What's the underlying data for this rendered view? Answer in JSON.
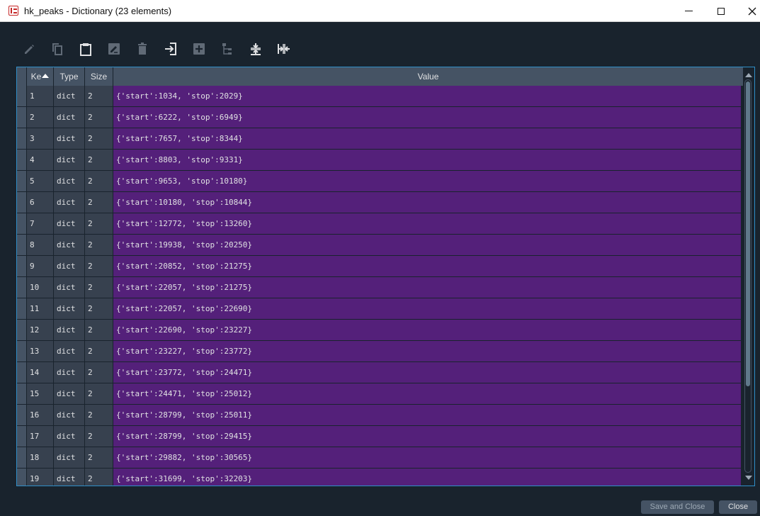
{
  "window": {
    "title": "hk_peaks - Dictionary (23 elements)",
    "icon": "spyder-app-icon",
    "controls": [
      "minimize-icon",
      "maximize-icon",
      "close-icon"
    ]
  },
  "toolbar": {
    "icons": [
      "edit-icon",
      "copy-icon",
      "paste-icon",
      "rename-icon",
      "delete-icon",
      "insert-icon",
      "insert-above-icon",
      "view-tree-icon",
      "resize-rows-icon",
      "resize-columns-icon"
    ]
  },
  "table": {
    "headers": {
      "key": "Ke",
      "type": "Type",
      "size": "Size",
      "value": "Value"
    },
    "sort_column": "key",
    "sort_order": "ascending",
    "rows": [
      {
        "key": "1",
        "type": "dict",
        "size": "2",
        "value": "{'start':1034, 'stop':2029}"
      },
      {
        "key": "2",
        "type": "dict",
        "size": "2",
        "value": "{'start':6222, 'stop':6949}"
      },
      {
        "key": "3",
        "type": "dict",
        "size": "2",
        "value": "{'start':7657, 'stop':8344}"
      },
      {
        "key": "4",
        "type": "dict",
        "size": "2",
        "value": "{'start':8803, 'stop':9331}"
      },
      {
        "key": "5",
        "type": "dict",
        "size": "2",
        "value": "{'start':9653, 'stop':10180}"
      },
      {
        "key": "6",
        "type": "dict",
        "size": "2",
        "value": "{'start':10180, 'stop':10844}"
      },
      {
        "key": "7",
        "type": "dict",
        "size": "2",
        "value": "{'start':12772, 'stop':13260}"
      },
      {
        "key": "8",
        "type": "dict",
        "size": "2",
        "value": "{'start':19938, 'stop':20250}"
      },
      {
        "key": "9",
        "type": "dict",
        "size": "2",
        "value": "{'start':20852, 'stop':21275}"
      },
      {
        "key": "10",
        "type": "dict",
        "size": "2",
        "value": "{'start':22057, 'stop':21275}"
      },
      {
        "key": "11",
        "type": "dict",
        "size": "2",
        "value": "{'start':22057, 'stop':22690}"
      },
      {
        "key": "12",
        "type": "dict",
        "size": "2",
        "value": "{'start':22690, 'stop':23227}"
      },
      {
        "key": "13",
        "type": "dict",
        "size": "2",
        "value": "{'start':23227, 'stop':23772}"
      },
      {
        "key": "14",
        "type": "dict",
        "size": "2",
        "value": "{'start':23772, 'stop':24471}"
      },
      {
        "key": "15",
        "type": "dict",
        "size": "2",
        "value": "{'start':24471, 'stop':25012}"
      },
      {
        "key": "16",
        "type": "dict",
        "size": "2",
        "value": "{'start':28799, 'stop':25011}"
      },
      {
        "key": "17",
        "type": "dict",
        "size": "2",
        "value": "{'start':28799, 'stop':29415}"
      },
      {
        "key": "18",
        "type": "dict",
        "size": "2",
        "value": "{'start':29882, 'stop':30565}"
      },
      {
        "key": "19",
        "type": "dict",
        "size": "2",
        "value": "{'start':31699, 'stop':32203}"
      }
    ]
  },
  "footer": {
    "save_close_label": "Save and Close",
    "close_label": "Close"
  },
  "colors": {
    "background": "#19232d",
    "header": "#455364",
    "value_highlight": "#54207a",
    "key_cells": "#37414f",
    "accent_border": "#2f8ec7",
    "text": "#e0e1e3"
  }
}
